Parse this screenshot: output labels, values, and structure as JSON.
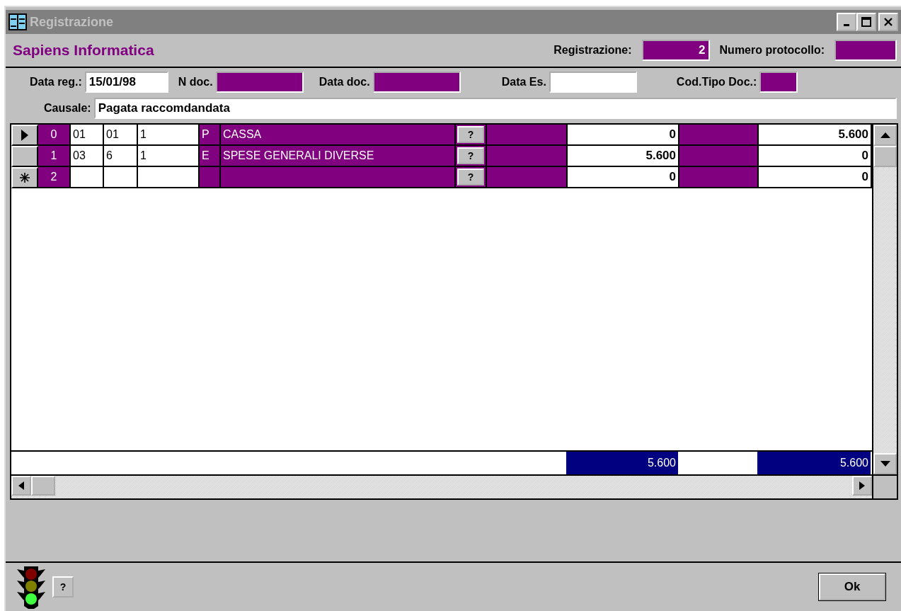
{
  "window": {
    "title": "Registrazione"
  },
  "header": {
    "company": "Sapiens Informatica",
    "registrazione": {
      "label": "Registrazione:",
      "value": "2",
      "readonly": true
    },
    "numero_protocollo": {
      "label": "Numero protocollo:",
      "readonly": true
    }
  },
  "fields": [
    {
      "label": "Data reg.:",
      "value": "15/01/98",
      "readonly": false
    },
    {
      "label": "N doc.",
      "readonly": true
    },
    {
      "label": "Data doc.",
      "readonly": true
    },
    {
      "label": "Data Es.",
      "readonly": false
    },
    {
      "label": "Cod.Tipo Doc.:",
      "readonly": true
    }
  ],
  "causale": {
    "label": "Causale:",
    "value": "Pagata raccomdandata"
  },
  "grid": {
    "rows": [
      {
        "kind": "current",
        "number": "0",
        "column_2": "01",
        "column_3": "01",
        "column_4": "1",
        "column_5": "P",
        "column_6": "CASSA",
        "help_button": "?",
        "column_9": "0",
        "column_11": "5.600"
      },
      {
        "kind": "none",
        "number": "1",
        "column_2": "03",
        "column_3": "6",
        "column_4": "1",
        "column_5": "E",
        "column_6": "SPESE GENERALI DIVERSE",
        "help_button": "?",
        "column_9": "5.600",
        "column_11": "0"
      },
      {
        "kind": "new",
        "number": "2",
        "help_button": "?",
        "column_9": "0",
        "column_11": "0"
      }
    ],
    "totals": {
      "column_9": "5.600",
      "column_11": "5.600"
    }
  },
  "footer": {
    "help_button": "?",
    "ok_button": "Ok"
  }
}
